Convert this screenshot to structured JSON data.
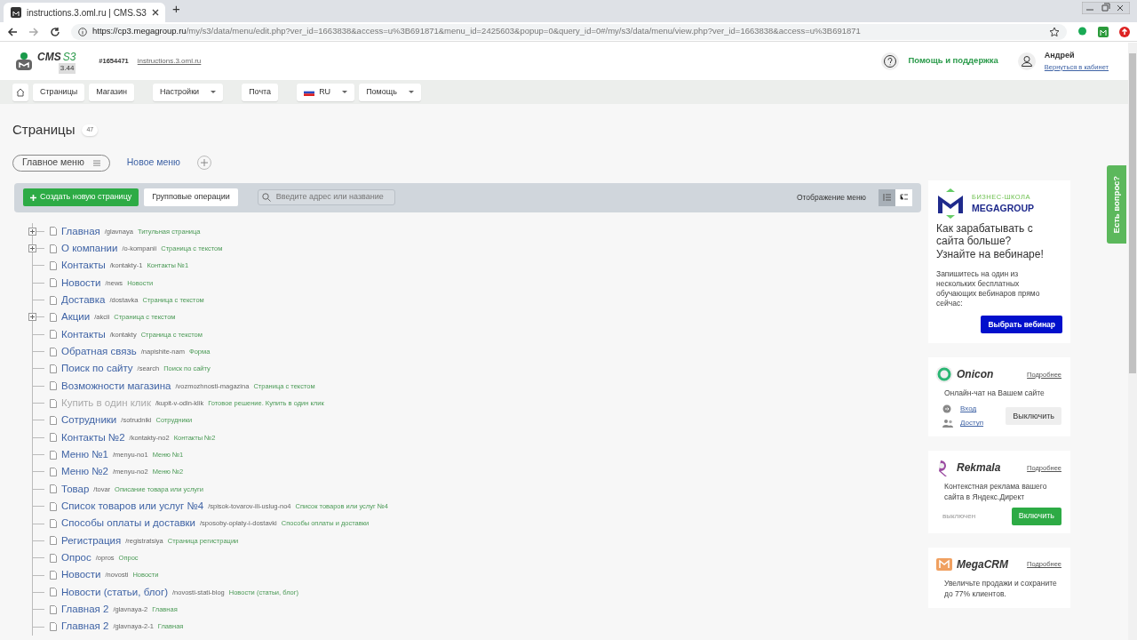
{
  "browser": {
    "tab_title": "instructions.3.oml.ru | CMS.S3",
    "new_tab": "+",
    "url_host": "https://cp3.megagroup.ru",
    "url_path": "/my/s3/data/menu/edit.php?ver_id=1663838&access=u%3B691871&menu_id=2425603&popup=0&query_id=0#/my/s3/data/menu/view.php?ver_id=1663838&access=u%3B691871"
  },
  "header": {
    "logo_text": "CMS",
    "logo_accent": "S3",
    "version": "3.44",
    "site_id": "#1654471",
    "domain": "instructions.3.oml.ru",
    "help": "Помощь и поддержка",
    "user_name": "Андрей",
    "user_link": "Вернуться в кабинет"
  },
  "nav": [
    {
      "label": "Страницы",
      "dropdown": false,
      "kind": "button"
    },
    {
      "label": "Магазин",
      "dropdown": false,
      "kind": "button"
    },
    {
      "label": "Настройки",
      "dropdown": true,
      "kind": "button"
    },
    {
      "label": "Почта",
      "dropdown": false,
      "kind": "button"
    },
    {
      "label": "RU",
      "dropdown": true,
      "kind": "language"
    },
    {
      "label": "Помощь",
      "dropdown": true,
      "kind": "button"
    }
  ],
  "page": {
    "title": "Страницы",
    "count": "47"
  },
  "menu_tabs": [
    {
      "label": "Главное меню",
      "selected": true
    },
    {
      "label": "Новое меню",
      "selected": false
    }
  ],
  "toolbar": {
    "create": "Создать новую страницу",
    "group_ops": "Групповые операции",
    "search_placeholder": "Введите адрес или название",
    "view_label": "Отображение меню",
    "view_modes": [
      {
        "kind": "list",
        "selected": true
      },
      {
        "kind": "tree",
        "selected": false
      }
    ]
  },
  "pages": [
    {
      "title": "Главная",
      "path": "/glavnaya",
      "type": "Титульная страница",
      "expandable": true,
      "disabled": false
    },
    {
      "title": "О компании",
      "path": "/o-kompanii",
      "type": "Страница с текстом",
      "expandable": true,
      "disabled": false
    },
    {
      "title": "Контакты",
      "path": "/kontakty-1",
      "type": "Контакты №1",
      "expandable": false,
      "disabled": false
    },
    {
      "title": "Новости",
      "path": "/news",
      "type": "Новости",
      "expandable": false,
      "disabled": false
    },
    {
      "title": "Доставка",
      "path": "/dostavka",
      "type": "Страница с текстом",
      "expandable": false,
      "disabled": false
    },
    {
      "title": "Акции",
      "path": "/akcii",
      "type": "Страница с текстом",
      "expandable": true,
      "disabled": false
    },
    {
      "title": "Контакты",
      "path": "/kontakty",
      "type": "Страница с текстом",
      "expandable": false,
      "disabled": false
    },
    {
      "title": "Обратная связь",
      "path": "/napishite-nam",
      "type": "Форма",
      "expandable": false,
      "disabled": false
    },
    {
      "title": "Поиск по сайту",
      "path": "/search",
      "type": "Поиск по сайту",
      "expandable": false,
      "disabled": false
    },
    {
      "title": "Возможности магазина",
      "path": "/vozmozhnosti-magazina",
      "type": "Страница с текстом",
      "expandable": false,
      "disabled": false
    },
    {
      "title": "Купить в один клик",
      "path": "/kupit-v-odin-klik",
      "type": "Готовое решение. Купить в один клик",
      "expandable": false,
      "disabled": true
    },
    {
      "title": "Сотрудники",
      "path": "/sotrudniki",
      "type": "Сотрудники",
      "expandable": false,
      "disabled": false
    },
    {
      "title": "Контакты №2",
      "path": "/kontakty-no2",
      "type": "Контакты №2",
      "expandable": false,
      "disabled": false
    },
    {
      "title": "Меню №1",
      "path": "/menyu-no1",
      "type": "Меню №1",
      "expandable": false,
      "disabled": false
    },
    {
      "title": "Меню №2",
      "path": "/menyu-no2",
      "type": "Меню №2",
      "expandable": false,
      "disabled": false
    },
    {
      "title": "Товар",
      "path": "/tovar",
      "type": "Описание товара или услуги",
      "expandable": false,
      "disabled": false
    },
    {
      "title": "Список товаров или услуг №4",
      "path": "/spisok-tovarov-ili-uslug-no4",
      "type": "Список товаров или услуг №4",
      "expandable": false,
      "disabled": false
    },
    {
      "title": "Способы оплаты и доставки",
      "path": "/sposoby-oplaty-i-dostavki",
      "type": "Способы оплаты и доставки",
      "expandable": false,
      "disabled": false
    },
    {
      "title": "Регистрация",
      "path": "/registratsiya",
      "type": "Страница регистрации",
      "expandable": false,
      "disabled": false
    },
    {
      "title": "Опрос",
      "path": "/opros",
      "type": "Опрос",
      "expandable": false,
      "disabled": false
    },
    {
      "title": "Новости",
      "path": "/novosti",
      "type": "Новости",
      "expandable": false,
      "disabled": false
    },
    {
      "title": "Новости (статьи, блог)",
      "path": "/novosti-stati-blog",
      "type": "Новости (статьи, блог)",
      "expandable": false,
      "disabled": false
    },
    {
      "title": "Главная 2",
      "path": "/glavnaya-2",
      "type": "Главная",
      "expandable": false,
      "disabled": false
    },
    {
      "title": "Главная 2",
      "path": "/glavnaya-2-1",
      "type": "Главная",
      "expandable": false,
      "disabled": false
    }
  ],
  "promo": {
    "school_top": "БИЗНЕС-ШКОЛА",
    "school_name": "MEGAGROUP",
    "headline": "Как зарабатывать с сайта больше? Узнайте на вебинаре!",
    "text": "Запишитесь на один из нескольких бесплатных обучающих вебинаров прямо сейчас:",
    "button": "Выбрать вебинар"
  },
  "services": [
    {
      "kind": "onicon",
      "name": "Onicon",
      "more": "Подробнее",
      "text": "Онлайн-чат на Вашем сайте",
      "on": true,
      "links": [
        "Вход",
        "Доступ"
      ],
      "button": "Выключить"
    },
    {
      "kind": "rekmala",
      "name": "Rekmala",
      "more": "Подробнее",
      "text": "Контекстная реклама вашего сайта в Яндекс.Директ",
      "on": false,
      "status": "выключен",
      "button": "Включить"
    },
    {
      "kind": "megacrm",
      "name": "MegaCRM",
      "more": "Подробнее",
      "text": "Увеличьте продажи и сохраните до 77% клиентов."
    }
  ],
  "question_tab": "Есть вопрос?"
}
